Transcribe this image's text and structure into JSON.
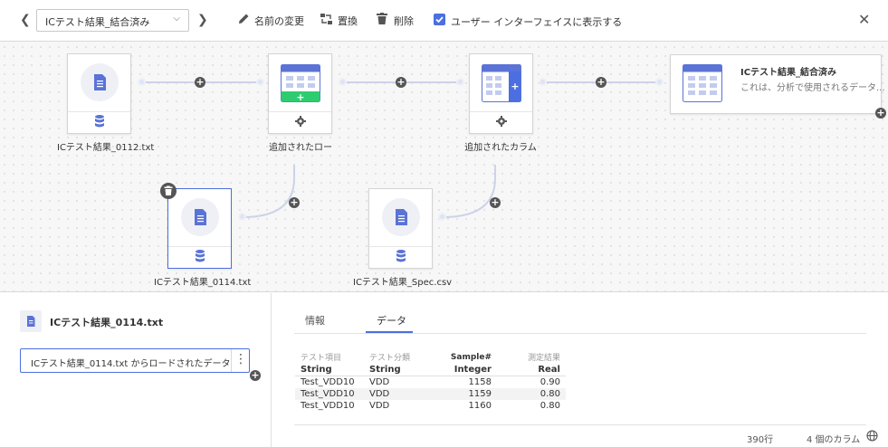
{
  "toolbar": {
    "dropdown_value": "ICテスト結果_結合済み",
    "rename_label": "名前の変更",
    "replace_label": "置換",
    "delete_label": "削除",
    "show_in_ui_label": "ユーザー インターフェイスに表示する",
    "show_in_ui_checked": true
  },
  "flow": {
    "nodes": [
      {
        "id": "src1",
        "label": "ICテスト結果_0112.txt"
      },
      {
        "id": "addrow",
        "label": "追加されたロー"
      },
      {
        "id": "addcol",
        "label": "追加されたカラム"
      },
      {
        "id": "src2",
        "label": "ICテスト結果_0114.txt"
      },
      {
        "id": "src3",
        "label": "ICテスト結果_Spec.csv"
      }
    ],
    "output": {
      "title": "ICテスト結果_結合済み",
      "description": "これは、分析で使用されるデータ..."
    }
  },
  "details": {
    "file_title": "ICテスト結果_0114.txt",
    "step_label": "ICテスト結果_0114.txt からロードされたデータ"
  },
  "tabs": [
    {
      "label": "情報"
    },
    {
      "label": "データ"
    }
  ],
  "table": {
    "headers": [
      "テスト項目",
      "テスト分類",
      "Sample#",
      "測定結果"
    ],
    "types": [
      "String",
      "String",
      "Integer",
      "Real"
    ],
    "rows": [
      [
        "Test_VDD10",
        "VDD",
        "1158",
        "0.90"
      ],
      [
        "Test_VDD10",
        "VDD",
        "1159",
        "0.80"
      ],
      [
        "Test_VDD10",
        "VDD",
        "1160",
        "0.80"
      ]
    ]
  },
  "footer": {
    "rows": "390行",
    "columns": "4 個のカラム"
  },
  "colors": {
    "accent": "#4b6fe0",
    "add_row_bar": "#2ecc71",
    "icon": "#6a7fdb"
  }
}
